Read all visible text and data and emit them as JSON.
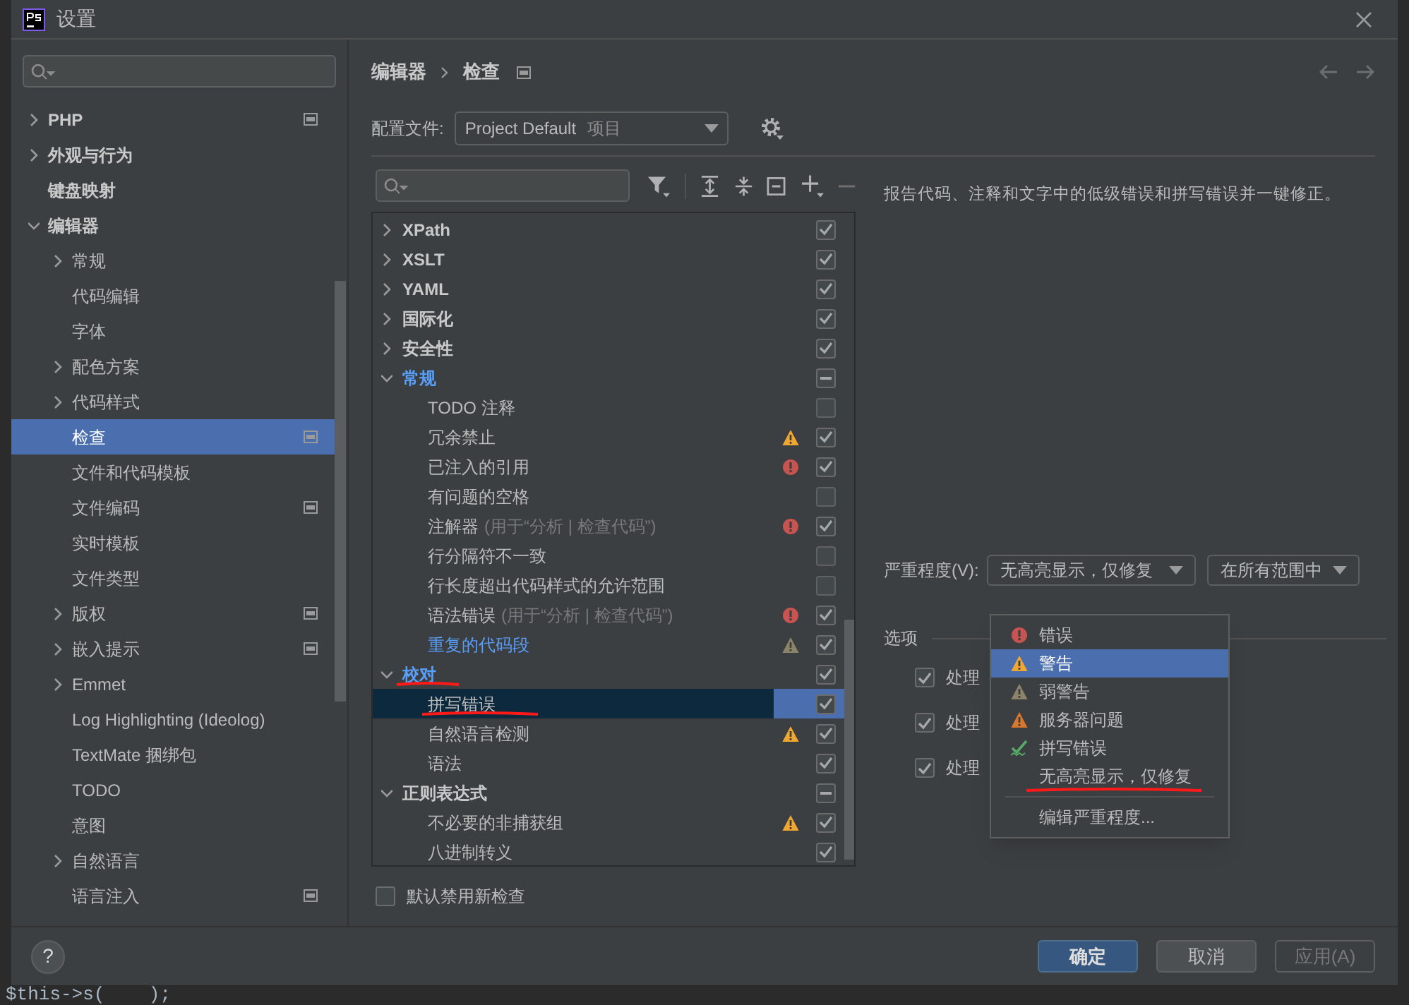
{
  "window": {
    "title": "设置"
  },
  "sidebar": {
    "items": [
      {
        "label": "PHP",
        "expanded": false,
        "scoped": true,
        "selected": false
      },
      {
        "label": "外观与行为",
        "expanded": false,
        "scoped": false,
        "selected": false
      },
      {
        "label": "键盘映射",
        "scoped": false,
        "selected": false
      },
      {
        "label": "编辑器",
        "expanded": true,
        "scoped": false,
        "selected": false,
        "children": [
          {
            "label": "常规",
            "expanded": false,
            "scoped": false,
            "selected": false
          },
          {
            "label": "代码编辑",
            "scoped": false,
            "selected": false
          },
          {
            "label": "字体",
            "scoped": false,
            "selected": false
          },
          {
            "label": "配色方案",
            "expanded": false,
            "scoped": false,
            "selected": false
          },
          {
            "label": "代码样式",
            "expanded": false,
            "scoped": false,
            "selected": false
          },
          {
            "label": "检查",
            "scoped": true,
            "selected": true
          },
          {
            "label": "文件和代码模板",
            "scoped": false,
            "selected": false
          },
          {
            "label": "文件编码",
            "scoped": true,
            "selected": false
          },
          {
            "label": "实时模板",
            "scoped": false,
            "selected": false
          },
          {
            "label": "文件类型",
            "scoped": false,
            "selected": false
          },
          {
            "label": "版权",
            "expanded": false,
            "scoped": true,
            "selected": false
          },
          {
            "label": "嵌入提示",
            "expanded": false,
            "scoped": true,
            "selected": false
          },
          {
            "label": "Emmet",
            "expanded": false,
            "scoped": false,
            "selected": false
          },
          {
            "label": "Log Highlighting (Ideolog)",
            "scoped": false,
            "selected": false
          },
          {
            "label": "TextMate 捆绑包",
            "scoped": false,
            "selected": false
          },
          {
            "label": "TODO",
            "scoped": false,
            "selected": false
          },
          {
            "label": "意图",
            "scoped": false,
            "selected": false
          },
          {
            "label": "自然语言",
            "expanded": false,
            "scoped": false,
            "selected": false
          },
          {
            "label": "语言注入",
            "scoped": true,
            "selected": false
          }
        ]
      }
    ]
  },
  "breadcrumb": {
    "items": [
      "编辑器",
      "检查"
    ],
    "scoped": true
  },
  "profile": {
    "label": "配置文件:",
    "value": "Project Default",
    "hint": "项目"
  },
  "inspections": [
    {
      "label": "XPath",
      "kind": "group",
      "expanded": false,
      "modified": false,
      "checked": true,
      "mixed": false,
      "underlined": false,
      "selected": false
    },
    {
      "label": "XSLT",
      "kind": "group",
      "expanded": false,
      "modified": false,
      "checked": true,
      "mixed": false,
      "underlined": false,
      "selected": false
    },
    {
      "label": "YAML",
      "kind": "group",
      "expanded": false,
      "modified": false,
      "checked": true,
      "mixed": false,
      "underlined": false,
      "selected": false
    },
    {
      "label": "国际化",
      "kind": "group",
      "expanded": false,
      "modified": false,
      "checked": true,
      "mixed": false,
      "underlined": false,
      "selected": false
    },
    {
      "label": "安全性",
      "kind": "group",
      "expanded": false,
      "modified": false,
      "checked": true,
      "mixed": false,
      "underlined": false,
      "selected": false
    },
    {
      "label": "常规",
      "kind": "group",
      "expanded": true,
      "modified": true,
      "checked": true,
      "mixed": true,
      "underlined": false,
      "selected": false,
      "children": [
        {
          "label": "TODO 注释",
          "kind": "item",
          "modified": false,
          "checked": false,
          "mixed": false,
          "underlined": false,
          "selected": false
        },
        {
          "label": "冗余禁止",
          "kind": "item",
          "modified": false,
          "color": "#f0a732",
          "checked": true,
          "mixed": false,
          "underlined": false,
          "selected": false
        },
        {
          "label": "已注入的引用",
          "kind": "item",
          "modified": false,
          "color": "#c75450",
          "checked": true,
          "mixed": false,
          "underlined": false,
          "selected": false
        },
        {
          "label": "有问题的空格",
          "kind": "item",
          "modified": false,
          "checked": false,
          "mixed": false,
          "underlined": false,
          "selected": false
        },
        {
          "label": "注解器",
          "suffix": "(用于“分析 | 检查代码”)",
          "kind": "item",
          "modified": false,
          "color": "#c75450",
          "checked": true,
          "mixed": false,
          "underlined": false,
          "selected": false
        },
        {
          "label": "行分隔符不一致",
          "kind": "item",
          "modified": false,
          "checked": false,
          "mixed": false,
          "underlined": false,
          "selected": false
        },
        {
          "label": "行长度超出代码样式的允许范围",
          "kind": "item",
          "modified": false,
          "checked": false,
          "mixed": false,
          "underlined": false,
          "selected": false
        },
        {
          "label": "语法错误",
          "suffix": "(用于“分析 | 检查代码”)",
          "kind": "item",
          "modified": false,
          "color": "#c75450",
          "checked": true,
          "mixed": false,
          "underlined": false,
          "selected": false
        },
        {
          "label": "重复的代码段",
          "kind": "item",
          "modified": true,
          "color": "#8c8468",
          "checked": true,
          "mixed": false,
          "underlined": false,
          "selected": false
        }
      ]
    },
    {
      "label": "校对",
      "kind": "group",
      "expanded": true,
      "modified": true,
      "checked": true,
      "mixed": false,
      "underlined": true,
      "selected": false,
      "children": [
        {
          "label": "拼写错误",
          "kind": "item",
          "modified": false,
          "checked": true,
          "mixed": false,
          "underlined": true,
          "selected": true
        },
        {
          "label": "自然语言检测",
          "kind": "item",
          "modified": false,
          "color": "#f0a732",
          "checked": true,
          "mixed": false,
          "underlined": false,
          "selected": false
        },
        {
          "label": "语法",
          "kind": "item",
          "modified": false,
          "checked": true,
          "mixed": false,
          "underlined": false,
          "selected": false
        }
      ]
    },
    {
      "label": "正则表达式",
      "kind": "group",
      "expanded": true,
      "modified": false,
      "checked": true,
      "mixed": true,
      "underlined": false,
      "selected": false,
      "children": [
        {
          "label": "不必要的非捕获组",
          "kind": "item",
          "modified": false,
          "color": "#f0a732",
          "checked": true,
          "mixed": false,
          "underlined": false,
          "selected": false
        },
        {
          "label": "八进制转义",
          "kind": "item",
          "modified": false,
          "checked": true,
          "mixed": false,
          "underlined": false,
          "selected": false
        }
      ]
    }
  ],
  "description": "报告代码、注释和文字中的低级错误和拼写错误并一键修正。",
  "severity": {
    "label": "严重程度(V):",
    "value": "无高亮显示，仅修复",
    "scope": "在所有范围中",
    "options": [
      {
        "label": "错误",
        "kind": "error",
        "highlighted": false,
        "underlined": false
      },
      {
        "label": "警告",
        "kind": "warning",
        "highlighted": true,
        "underlined": false
      },
      {
        "label": "弱警告",
        "kind": "weak_warning",
        "highlighted": false,
        "underlined": false
      },
      {
        "label": "服务器问题",
        "kind": "server",
        "highlighted": false,
        "underlined": false
      },
      {
        "label": "拼写错误",
        "kind": "typo",
        "highlighted": false,
        "underlined": false
      },
      {
        "label": "无高亮显示，仅修复",
        "kind": "plain",
        "highlighted": false,
        "underlined": true
      },
      {
        "label": "编辑严重程度...",
        "kind": "action",
        "highlighted": false,
        "underlined": false
      }
    ]
  },
  "options": {
    "title": "选项",
    "items": [
      {
        "label": "处理",
        "checked": true
      },
      {
        "label": "处理",
        "checked": true
      },
      {
        "label": "处理",
        "checked": true
      }
    ]
  },
  "disable_new": {
    "label": "默认禁用新检查",
    "checked": false
  },
  "buttons": [
    {
      "label": "确定",
      "default": true,
      "disabled": false
    },
    {
      "label": "取消",
      "default": false,
      "disabled": false
    },
    {
      "label": "应用(A)",
      "default": false,
      "disabled": true
    }
  ],
  "help": "?",
  "background_code": "$this->s(    );"
}
